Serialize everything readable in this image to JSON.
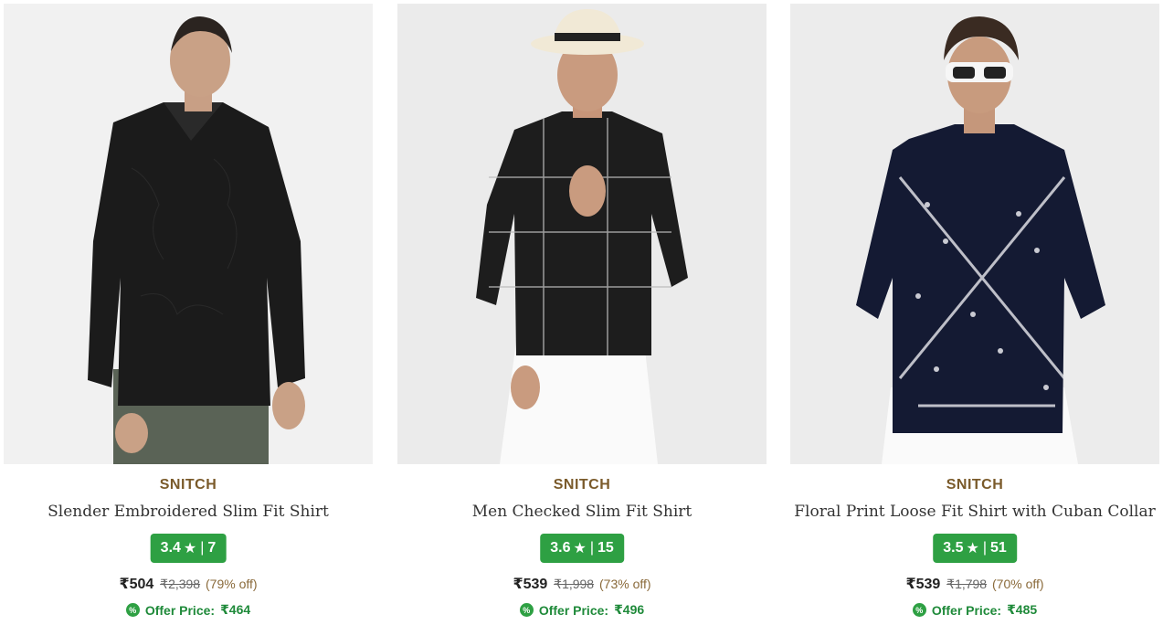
{
  "products": [
    {
      "brand": "SNITCH",
      "title": "Slender Embroidered Slim Fit Shirt",
      "rating": "3.4",
      "reviews": "7",
      "price": "₹504",
      "mrp": "₹2,398",
      "discount": "(79% off)",
      "offer_label": "Offer Price:",
      "offer_price": "₹464",
      "image_icon": "model-black-embroidered-shirt"
    },
    {
      "brand": "SNITCH",
      "title": "Men Checked Slim Fit Shirt",
      "rating": "3.6",
      "reviews": "15",
      "price": "₹539",
      "mrp": "₹1,998",
      "discount": "(73% off)",
      "offer_label": "Offer Price:",
      "offer_price": "₹496",
      "image_icon": "model-black-checked-shirt"
    },
    {
      "brand": "SNITCH",
      "title": "Floral Print Loose Fit Shirt with Cuban Collar",
      "rating": "3.5",
      "reviews": "51",
      "price": "₹539",
      "mrp": "₹1,798",
      "discount": "(70% off)",
      "offer_label": "Offer Price:",
      "offer_price": "₹485",
      "image_icon": "model-navy-bandana-print-shirt"
    }
  ],
  "colors": {
    "brand": "#7a5a2a",
    "rating_bg": "#2ea043",
    "offer_text": "#1f8a3a"
  },
  "rating_star": "★",
  "rating_sep": "|",
  "offer_icon_glyph": "%"
}
